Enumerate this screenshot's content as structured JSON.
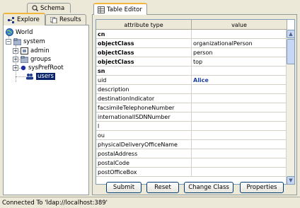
{
  "left_tabs": {
    "schema": "Schema",
    "explore": "Explore",
    "results": "Results"
  },
  "tree": {
    "root": "World",
    "system": "system",
    "children": [
      "admin",
      "groups",
      "sysPrefRoot",
      "users"
    ],
    "selected": "users"
  },
  "editor_tab": "Table Editor",
  "table": {
    "headers": [
      "attribute type",
      "value"
    ],
    "rows": [
      {
        "type": "cn",
        "value": "",
        "type_bold": true
      },
      {
        "type": "objectClass",
        "value": "organizationalPerson",
        "type_bold": true
      },
      {
        "type": "objectClass",
        "value": "person",
        "type_bold": true
      },
      {
        "type": "objectClass",
        "value": "top",
        "type_bold": true
      },
      {
        "type": "sn",
        "value": "",
        "type_bold": true
      },
      {
        "type": "uid",
        "value": "Alice"
      },
      {
        "type": "description",
        "value": ""
      },
      {
        "type": "destinationIndicator",
        "value": ""
      },
      {
        "type": "facsimileTelephoneNumber",
        "value": ""
      },
      {
        "type": "internationalISDNNumber",
        "value": ""
      },
      {
        "type": "l",
        "value": ""
      },
      {
        "type": "ou",
        "value": ""
      },
      {
        "type": "physicalDeliveryOfficeName",
        "value": ""
      },
      {
        "type": "postalAddress",
        "value": ""
      },
      {
        "type": "postalCode",
        "value": ""
      },
      {
        "type": "postOfficeBox",
        "value": ""
      }
    ]
  },
  "buttons": {
    "submit": "Submit",
    "reset": "Reset",
    "change_class": "Change Class",
    "properties": "Properties"
  },
  "status": "Connected To 'ldap://localhost:389'"
}
